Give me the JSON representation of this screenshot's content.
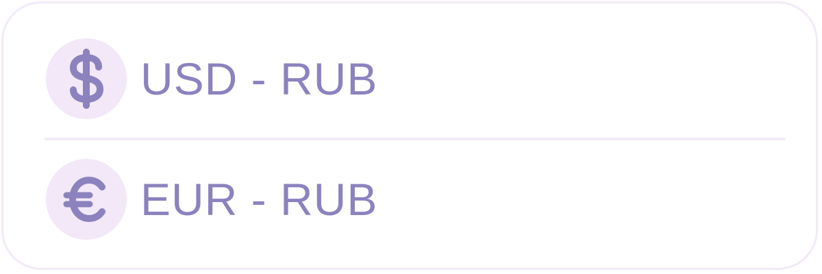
{
  "currency_list": {
    "items": [
      {
        "icon": "dollar-icon",
        "label": "USD - RUB"
      },
      {
        "icon": "euro-icon",
        "label": "EUR - RUB"
      }
    ]
  },
  "colors": {
    "accent": "#8C82BE",
    "icon_background": "#F2E8F8",
    "border": "#F2EAF7"
  }
}
